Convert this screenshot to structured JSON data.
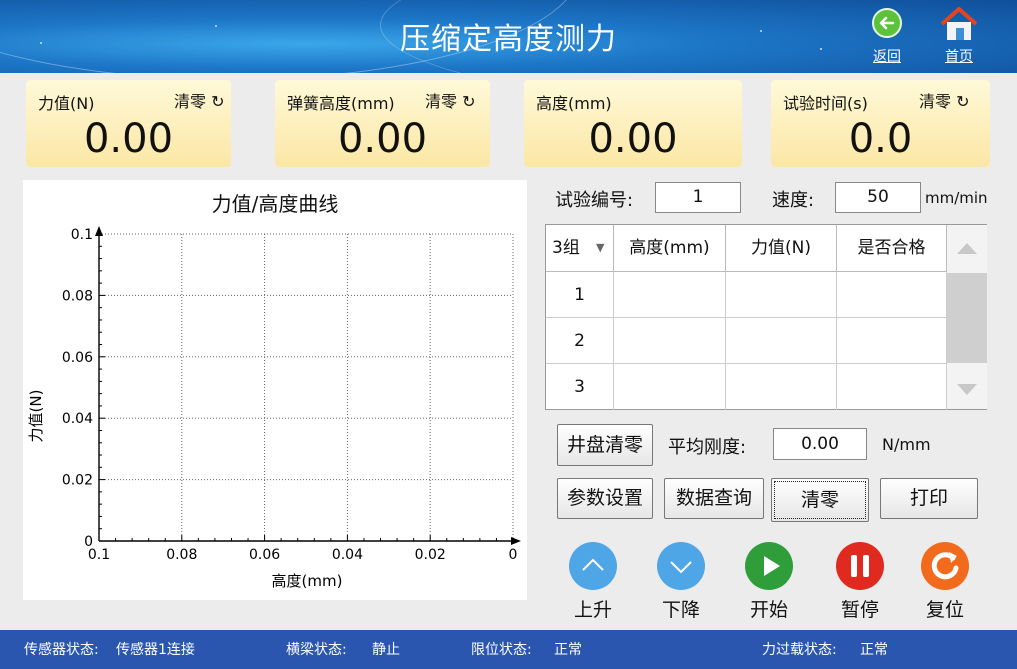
{
  "header": {
    "title": "压缩定高度测力",
    "back_label": "返回",
    "home_label": "首页"
  },
  "panels": [
    {
      "label": "力值(N)",
      "zero": "清零",
      "value": "0.00"
    },
    {
      "label": "弹簧高度(mm)",
      "zero": "清零",
      "value": "0.00"
    },
    {
      "label": "高度(mm)",
      "value": "0.00"
    },
    {
      "label": "试验时间(s)",
      "zero": "清零",
      "value": "0.0"
    }
  ],
  "chart_data": {
    "type": "line",
    "title": "力值/高度曲线",
    "xlabel": "高度(mm)",
    "ylabel": "力值(N)",
    "x_ticks": [
      "0.1",
      "0.08",
      "0.06",
      "0.04",
      "0.02",
      "0"
    ],
    "y_ticks": [
      "0",
      "0.02",
      "0.04",
      "0.06",
      "0.08",
      "0.1"
    ],
    "xlim": [
      0.1,
      0
    ],
    "ylim": [
      0,
      0.1
    ],
    "grid": true,
    "series": []
  },
  "form": {
    "test_no_label": "试验编号:",
    "test_no_value": "1",
    "speed_label": "速度:",
    "speed_value": "50",
    "speed_unit": "mm/min"
  },
  "table": {
    "group_select": "3组",
    "headers": [
      "高度(mm)",
      "力值(N)",
      "是否合格"
    ],
    "rows": [
      {
        "no": "1",
        "height": "",
        "force": "",
        "pass": ""
      },
      {
        "no": "2",
        "height": "",
        "force": "",
        "pass": ""
      },
      {
        "no": "3",
        "height": "",
        "force": "",
        "pass": ""
      }
    ]
  },
  "stiffness": {
    "button": "井盘清零",
    "label": "平均刚度:",
    "value": "0.00",
    "unit": "N/mm"
  },
  "buttons": {
    "params": "参数设置",
    "query": "数据查询",
    "zero": "清零",
    "print": "打印"
  },
  "controls": [
    {
      "label": "上升",
      "color": "#4fa6e6",
      "icon": "chevron-up-icon"
    },
    {
      "label": "下降",
      "color": "#4fa6e6",
      "icon": "chevron-down-icon"
    },
    {
      "label": "开始",
      "color": "#2f9e3a",
      "icon": "play-icon"
    },
    {
      "label": "暂停",
      "color": "#e12a1f",
      "icon": "pause-icon"
    },
    {
      "label": "复位",
      "color": "#f26a1b",
      "icon": "reset-icon"
    }
  ],
  "status": {
    "sensor_label": "传感器状态:",
    "sensor_value": "传感器1连接",
    "beam_label": "横梁状态:",
    "beam_value": "静止",
    "limit_label": "限位状态:",
    "limit_value": "正常",
    "overload_label": "力过载状态:",
    "overload_value": "正常"
  }
}
